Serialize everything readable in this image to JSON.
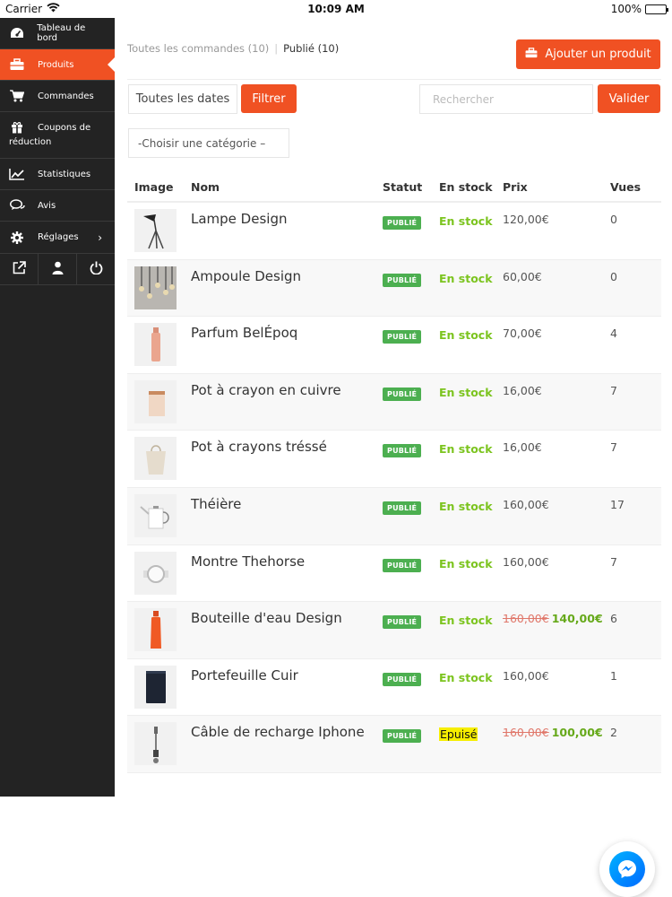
{
  "status_bar": {
    "carrier": "Carrier",
    "time": "10:09 AM",
    "battery": "100%"
  },
  "sidebar": {
    "items": [
      {
        "label": "Tableau de bord",
        "icon": "dashboard-icon"
      },
      {
        "label": "Produits",
        "icon": "briefcase-icon",
        "active": true
      },
      {
        "label": "Commandes",
        "icon": "cart-icon"
      },
      {
        "label_line1": "Coupons de",
        "label_line2": "réduction",
        "icon": "gift-icon"
      },
      {
        "label": "Statistiques",
        "icon": "chart-icon"
      },
      {
        "label": "Avis",
        "icon": "comments-icon"
      },
      {
        "label": "Réglages",
        "icon": "gear-icon",
        "chevron": "›"
      }
    ],
    "actions": [
      "external-link-icon",
      "user-icon",
      "power-icon"
    ]
  },
  "main": {
    "filter_all": "Toutes les commandes (10)",
    "filter_published": "Publié (10)",
    "add_product": "Ajouter un produit",
    "date_select": "Toutes les dates",
    "filter_button": "Filtrer",
    "search_placeholder": "Rechercher",
    "validate_button": "Valider",
    "category_select": "-Choisir une catégorie –"
  },
  "table": {
    "headers": {
      "image": "Image",
      "name": "Nom",
      "status": "Statut",
      "stock": "En stock",
      "price": "Prix",
      "views": "Vues"
    },
    "rows": [
      {
        "name": "Lampe Design",
        "status": "PUBLIÉ",
        "stock": "En stock",
        "price": "120,00€",
        "old_price": "",
        "views": "0",
        "thumb": "lamp"
      },
      {
        "name": "Ampoule Design",
        "status": "PUBLIÉ",
        "stock": "En stock",
        "price": "60,00€",
        "old_price": "",
        "views": "0",
        "thumb": "bulbs"
      },
      {
        "name": "Parfum BelÉpoq",
        "status": "PUBLIÉ",
        "stock": "En stock",
        "price": "70,00€",
        "old_price": "",
        "views": "4",
        "thumb": "perfume"
      },
      {
        "name": "Pot à crayon en cuivre",
        "status": "PUBLIÉ",
        "stock": "En stock",
        "price": "16,00€",
        "old_price": "",
        "views": "7",
        "thumb": "copper-pot"
      },
      {
        "name": "Pot à crayons tréssé",
        "status": "PUBLIÉ",
        "stock": "En stock",
        "price": "16,00€",
        "old_price": "",
        "views": "7",
        "thumb": "woven-pot"
      },
      {
        "name": "Théière",
        "status": "PUBLIÉ",
        "stock": "En stock",
        "price": "160,00€",
        "old_price": "",
        "views": "17",
        "thumb": "teapot"
      },
      {
        "name": "Montre Thehorse",
        "status": "PUBLIÉ",
        "stock": "En stock",
        "price": "160,00€",
        "old_price": "",
        "views": "7",
        "thumb": "watch"
      },
      {
        "name": "Bouteille d'eau Design",
        "status": "PUBLIÉ",
        "stock": "En stock",
        "price": "140,00€",
        "old_price": "160,00€",
        "views": "6",
        "thumb": "bottle"
      },
      {
        "name": "Portefeuille Cuir",
        "status": "PUBLIÉ",
        "stock": "En stock",
        "price": "160,00€",
        "old_price": "",
        "views": "1",
        "thumb": "wallet"
      },
      {
        "name": "Câble de recharge Iphone",
        "status": "PUBLIÉ",
        "stock": "Epuisé",
        "price": "100,00€",
        "old_price": "160,00€",
        "views": "2",
        "thumb": "cable",
        "out_of_stock": true
      }
    ]
  },
  "colors": {
    "accent": "#f05123",
    "sidebar_bg": "#232323",
    "badge": "#4caf50",
    "in_stock": "#7cc41f",
    "sale_price": "#66a91a",
    "out_of_stock_highlight": "#f6ee00"
  }
}
